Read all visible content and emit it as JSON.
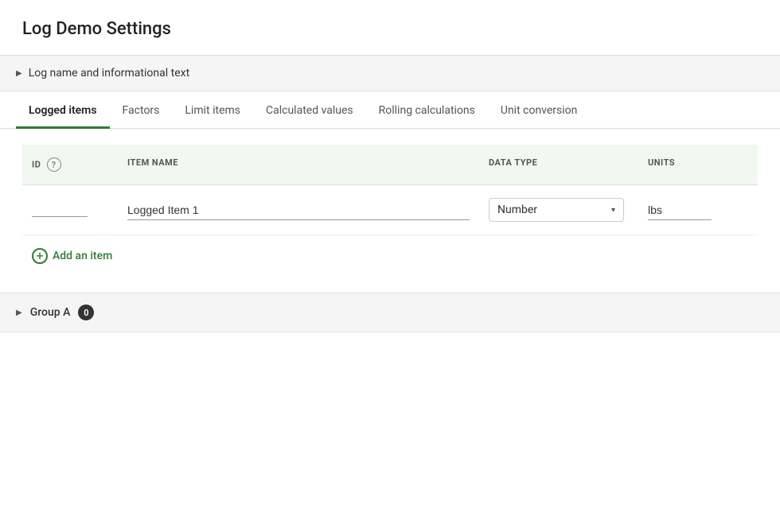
{
  "page": {
    "title": "Log Demo Settings"
  },
  "collapsible": {
    "label": "Log name and informational text"
  },
  "tabs": [
    {
      "id": "logged-items",
      "label": "Logged items",
      "active": true
    },
    {
      "id": "factors",
      "label": "Factors",
      "active": false
    },
    {
      "id": "limit-items",
      "label": "Limit items",
      "active": false
    },
    {
      "id": "calculated-values",
      "label": "Calculated values",
      "active": false
    },
    {
      "id": "rolling-calculations",
      "label": "Rolling calculations",
      "active": false
    },
    {
      "id": "unit-conversion",
      "label": "Unit conversion",
      "active": false
    }
  ],
  "table": {
    "headers": {
      "id": "ID",
      "item_name": "ITEM NAME",
      "data_type": "DATA TYPE",
      "units": "UNITS"
    },
    "rows": [
      {
        "id": "",
        "item_name": "Logged Item 1",
        "data_type": "Number",
        "units": "lbs"
      }
    ]
  },
  "add_item": {
    "label": "Add an item"
  },
  "group": {
    "label": "Group A",
    "badge": "0"
  },
  "icons": {
    "help": "?",
    "chevron_right": "▶",
    "chevron_down": "▾",
    "plus": "+"
  }
}
